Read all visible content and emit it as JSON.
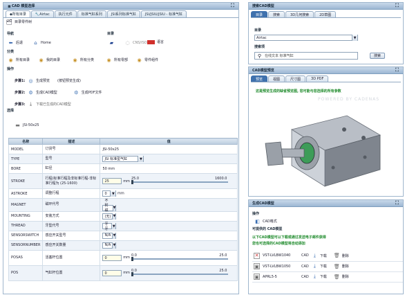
{
  "left": {
    "title": "CAD 模型选择",
    "breadcrumbs": [
      "所有目录",
      "Airtac",
      "执行元件",
      "标准气缸系列",
      "JSI系列标准气缸",
      "JSI/JSIU/JSIU - 标准气缸"
    ],
    "breadcrumb_sub": "目录零件树",
    "nav": {
      "label": "导航",
      "back": "后退",
      "home": "Home",
      "catalog_label": "目录",
      "variant": "CNS/ISO",
      "flag": "语言"
    },
    "class": {
      "label": "分类",
      "items": [
        "所有目录",
        "我的目录",
        "所有分类",
        "所有零部",
        "零件组件"
      ]
    },
    "ops": {
      "label": "操作",
      "step1": "步骤1:",
      "step1_a": "生成预览",
      "step1_b": "(按钮预览生成)",
      "step2": "步骤2:",
      "step2_a": "生成CAD模型",
      "step2_b": "生成PDF文件",
      "step3": "步骤3:",
      "step3_a": "下载已生成的CAD模型"
    },
    "select": {
      "label": "选择",
      "part_id": "JSI-50x25",
      "headers": [
        "名称",
        "描述",
        "值"
      ],
      "rows": [
        {
          "name": "MODEL",
          "desc": "订货号",
          "value": "JSI-50x25",
          "kind": "text"
        },
        {
          "name": "TYPE",
          "desc": "型号",
          "value": "JSI 标准型气缸",
          "kind": "select"
        },
        {
          "name": "BORE",
          "desc": "缸径",
          "value": "50 mm",
          "kind": "text"
        },
        {
          "name": "STROKE",
          "desc": "行程(标准行程及非标准行程-非标准行程为 (25-1600)",
          "value": "25",
          "unit": "mm",
          "min": "25.0",
          "max": "1600.0",
          "kind": "slider"
        },
        {
          "name": "ASTROKE",
          "desc": "调整行程",
          "value": "0",
          "unit": "mm",
          "kind": "select"
        },
        {
          "name": "MAGNET",
          "desc": "磁环代号",
          "value": "不附磁环",
          "kind": "select"
        },
        {
          "name": "MOUNTING",
          "desc": "安装方式",
          "value": "(无)",
          "kind": "select"
        },
        {
          "name": "THREAD",
          "desc": "牙型代号",
          "value": "牙牙",
          "kind": "select"
        },
        {
          "name": "SENSORSWITCH",
          "desc": "感应开关型号",
          "value": "N/A",
          "kind": "select"
        },
        {
          "name": "SENSORNUMBER",
          "desc": "感应开关数量",
          "value": "N/A",
          "kind": "select"
        },
        {
          "name": "POSAS",
          "desc": "活塞杆位置",
          "value": "0",
          "unit": "mm",
          "min": "0.0",
          "max": "25.0",
          "kind": "slider"
        },
        {
          "name": "POS",
          "desc": "气缸杆位置",
          "value": "0",
          "unit": "mm",
          "min": "0.0",
          "max": "25.0",
          "kind": "slider"
        }
      ]
    }
  },
  "search": {
    "title": "搜索CAD模型",
    "tabs": [
      "目录",
      "搜索",
      "3D几何搜索",
      "2D草图"
    ],
    "catalog_label": "目录",
    "catalog_value": "Airtac",
    "keyword_label": "搜索项",
    "keyword_placeholder": "在线文本 标准气缸",
    "search_btn": "搜索"
  },
  "preview": {
    "title": "CAD模型预览",
    "tabs": [
      "预览",
      "视图",
      "尺寸图",
      "3D PDF"
    ],
    "hint": "这是预览生成的缺省预览图, 您可能与您选择的所有参数",
    "watermark": "POWERED BY CADENAS"
  },
  "generate": {
    "title": "生成CAD模型",
    "ops_label": "操作",
    "formats_label": "CAD格式",
    "available_label": "可提供的 CAD模型",
    "note_line1": "以下CAD模型可以下载或通过发送电子邮件获得",
    "note_line2": "您也可选择的CAD模型将自动添加",
    "files": [
      {
        "name": "VST-LVLBW1040",
        "cad": "CAD",
        "dl": "下载",
        "del": "删除"
      },
      {
        "name": "VST-LVLBW1050",
        "cad": "CAD",
        "dl": "下载",
        "del": "删除"
      },
      {
        "name": "APRL5-5",
        "cad": "CAD",
        "dl": "下载",
        "del": "删除"
      }
    ]
  },
  "colors": {
    "header_top": "#c9d9ea",
    "header_bottom": "#9db7d3",
    "accent_tab": "#3f71ad",
    "hint_green": "#1d8a2a",
    "row_alt": "#eef3f9"
  }
}
